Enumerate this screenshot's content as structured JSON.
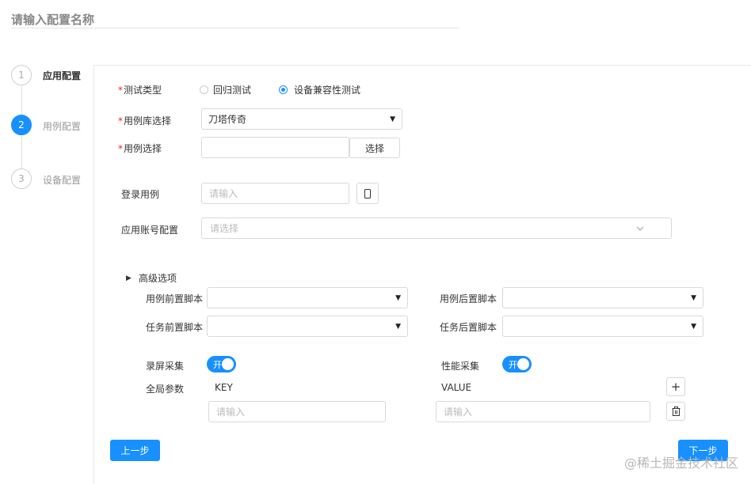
{
  "header": {
    "title": "请输入配置名称"
  },
  "steps": [
    {
      "number": "1",
      "label": "应用配置"
    },
    {
      "number": "2",
      "label": "用例配置"
    },
    {
      "number": "3",
      "label": "设备配置"
    }
  ],
  "form": {
    "test_type": {
      "label": "测试类型",
      "required_mark": "*",
      "options": [
        {
          "label": "回归测试",
          "checked": false
        },
        {
          "label": "设备兼容性测试",
          "checked": true
        }
      ]
    },
    "case_library": {
      "label": "用例库选择",
      "required_mark": "*",
      "value": "刀塔传奇"
    },
    "case_select": {
      "label": "用例选择",
      "required_mark": "*",
      "value": "",
      "button": "选择"
    },
    "login_case": {
      "label": "登录用例",
      "placeholder": "请输入"
    },
    "app_account": {
      "label": "应用账号配置",
      "placeholder": "请选择"
    },
    "advanced": {
      "toggle_label": "高级选项",
      "case_pre_script": {
        "label": "用例前置脚本",
        "value": ""
      },
      "case_post_script": {
        "label": "用例后置脚本",
        "value": ""
      },
      "task_pre_script": {
        "label": "任务前置脚本",
        "value": ""
      },
      "task_post_script": {
        "label": "任务后置脚本",
        "value": ""
      },
      "screen_record": {
        "label": "录屏采集",
        "state_label": "开",
        "on": true
      },
      "perf_collect": {
        "label": "性能采集",
        "state_label": "开",
        "on": true
      },
      "global_params": {
        "label": "全局参数",
        "key_header": "KEY",
        "value_header": "VALUE",
        "key_placeholder": "请输入",
        "value_placeholder": "请输入",
        "add_symbol": "+"
      }
    }
  },
  "footer": {
    "prev_label": "上一步",
    "next_label": "下一步"
  },
  "watermark": "@稀土掘金技术社区",
  "colors": {
    "primary": "#1890ff",
    "required": "#f5222d"
  }
}
